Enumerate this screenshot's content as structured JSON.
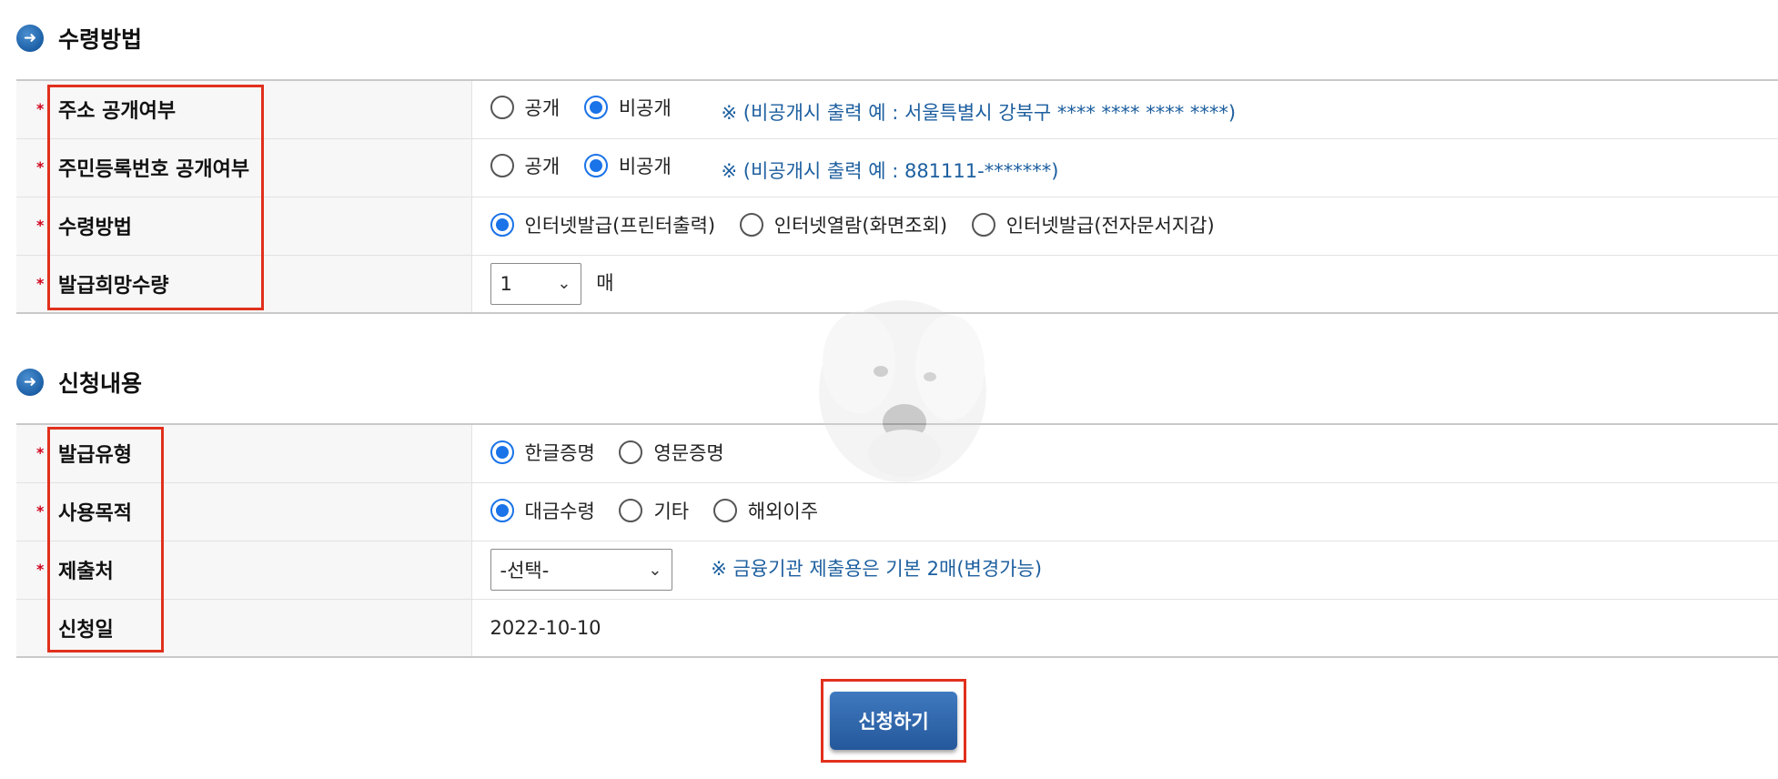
{
  "section1": {
    "title": "수령방법",
    "rows": [
      {
        "label": "주소 공개여부",
        "required": "*",
        "options": [
          "공개",
          "비공개"
        ],
        "selected": 1,
        "note": "※ (비공개시 출력 예 : 서울특별시 강북구 **** **** **** ****)"
      },
      {
        "label": "주민등록번호 공개여부",
        "required": "*",
        "options": [
          "공개",
          "비공개"
        ],
        "selected": 1,
        "note": "※ (비공개시 출력 예 : 881111-*******)"
      },
      {
        "label": "수령방법",
        "required": "*",
        "options": [
          "인터넷발급(프린터출력)",
          "인터넷열람(화면조회)",
          "인터넷발급(전자문서지갑)"
        ],
        "selected": 0
      },
      {
        "label": "발급희망수량",
        "required": "*",
        "select_value": "1",
        "unit": "매"
      }
    ]
  },
  "section2": {
    "title": "신청내용",
    "rows": [
      {
        "label": "발급유형",
        "required": "*",
        "options": [
          "한글증명",
          "영문증명"
        ],
        "selected": 0
      },
      {
        "label": "사용목적",
        "required": "*",
        "options": [
          "대금수령",
          "기타",
          "해외이주"
        ],
        "selected": 0
      },
      {
        "label": "제출처",
        "required": "*",
        "select_value": "-선택-",
        "note": "※ 금융기관 제출용은 기본 2매(변경가능)"
      },
      {
        "label": "신청일",
        "value": "2022-10-10"
      }
    ]
  },
  "submit_label": "신청하기",
  "icons": {
    "section_bullet": "arrow-right-circle-icon",
    "dropdown": "chevron-down-icon"
  },
  "colors": {
    "accent": "#1a73e8",
    "note": "#1d5f9f",
    "highlight_box": "#e1301d",
    "button": "#2f65a8"
  }
}
